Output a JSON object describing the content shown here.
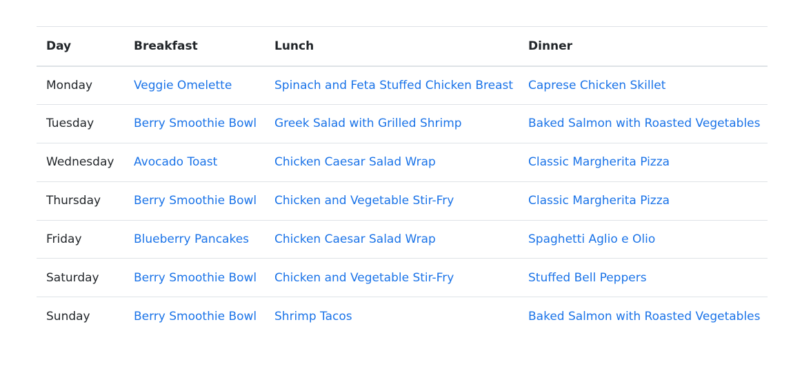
{
  "table": {
    "headers": {
      "day": "Day",
      "breakfast": "Breakfast",
      "lunch": "Lunch",
      "dinner": "Dinner"
    },
    "rows": [
      {
        "day": "Monday",
        "breakfast": "Veggie Omelette",
        "lunch": "Spinach and Feta Stuffed Chicken Breast",
        "dinner": "Caprese Chicken Skillet"
      },
      {
        "day": "Tuesday",
        "breakfast": "Berry Smoothie Bowl",
        "lunch": "Greek Salad with Grilled Shrimp",
        "dinner": "Baked Salmon with Roasted Vegetables"
      },
      {
        "day": "Wednesday",
        "breakfast": "Avocado Toast",
        "lunch": "Chicken Caesar Salad Wrap",
        "dinner": "Classic Margherita Pizza"
      },
      {
        "day": "Thursday",
        "breakfast": "Berry Smoothie Bowl",
        "lunch": "Chicken and Vegetable Stir-Fry",
        "dinner": "Classic Margherita Pizza"
      },
      {
        "day": "Friday",
        "breakfast": "Blueberry Pancakes",
        "lunch": "Chicken Caesar Salad Wrap",
        "dinner": "Spaghetti Aglio e Olio"
      },
      {
        "day": "Saturday",
        "breakfast": "Berry Smoothie Bowl",
        "lunch": "Chicken and Vegetable Stir-Fry",
        "dinner": "Stuffed Bell Peppers"
      },
      {
        "day": "Sunday",
        "breakfast": "Berry Smoothie Bowl",
        "lunch": "Shrimp Tacos",
        "dinner": "Baked Salmon with Roasted Vegetables"
      }
    ]
  },
  "colors": {
    "link": "#1a73e8",
    "text": "#212529",
    "border": "#dee2e6"
  }
}
